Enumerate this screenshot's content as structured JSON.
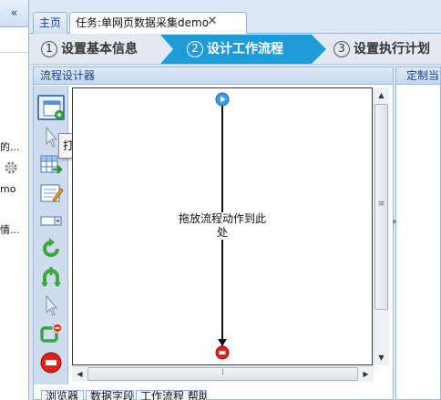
{
  "left_strip": {
    "collapse_label": "«",
    "snippets": [
      "的...",
      "mo",
      "情..."
    ]
  },
  "tabs": [
    {
      "label": "主页",
      "active": false
    },
    {
      "label": "任务:单网页数据采集demo",
      "active": true,
      "close": "✕"
    }
  ],
  "wizard": {
    "steps": [
      {
        "num": "1",
        "label": "设置基本信息",
        "active": false
      },
      {
        "num": "2",
        "label": "设计工作流程",
        "active": true
      },
      {
        "num": "3",
        "label": "设置执行计划",
        "active": false
      }
    ]
  },
  "designer": {
    "title": "流程设计器",
    "tooltip": "打开网页",
    "drop_hint": "拖放流程动作到此处",
    "tools": [
      "open-web-page-icon",
      "click-element-icon",
      "extract-data-icon",
      "input-text-icon",
      "select-dropdown-icon",
      "refresh-loop-icon",
      "if-condition-icon",
      "mouse-over-icon",
      "loop-icon",
      "stop-icon"
    ]
  },
  "right_panel": {
    "title": "定制当前"
  },
  "bottom_tabs": [
    "浏览器",
    "数据字段",
    "工作流程 帮助"
  ],
  "colors": {
    "accent": "#1f9bd7",
    "header_text": "#15428b",
    "border": "#99bbe8",
    "end_node": "#e0201b"
  }
}
